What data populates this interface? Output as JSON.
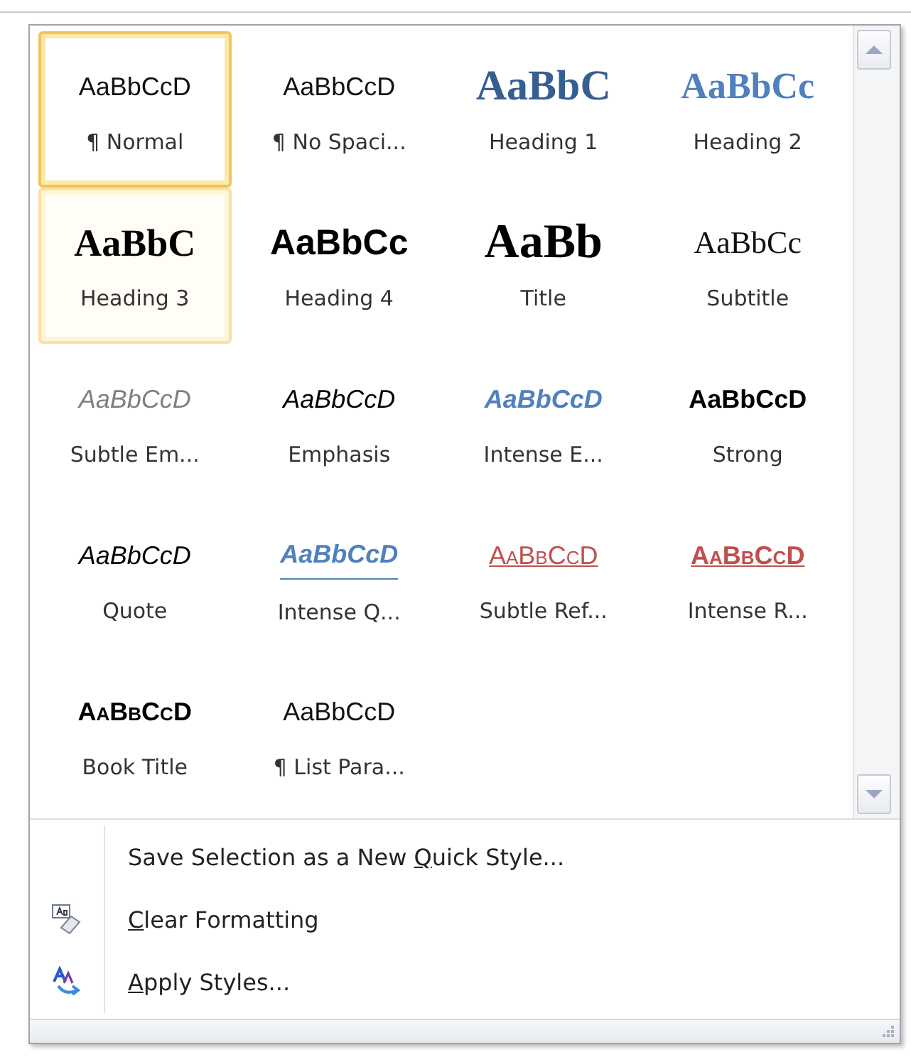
{
  "styles": [
    {
      "preview": "AaBbCcD",
      "label": "¶ Normal",
      "kind": "normal",
      "selected": true,
      "hovered": false
    },
    {
      "preview": "AaBbCcD",
      "label": "¶ No Spaci...",
      "kind": "no_spacing",
      "selected": false,
      "hovered": false
    },
    {
      "preview": "AaBbC",
      "label": "Heading 1",
      "kind": "heading1",
      "selected": false,
      "hovered": false
    },
    {
      "preview": "AaBbCc",
      "label": "Heading 2",
      "kind": "heading2",
      "selected": false,
      "hovered": false
    },
    {
      "preview": "AaBbC",
      "label": "Heading 3",
      "kind": "heading3",
      "selected": false,
      "hovered": true
    },
    {
      "preview": "AaBbCc",
      "label": "Heading 4",
      "kind": "heading4",
      "selected": false,
      "hovered": false
    },
    {
      "preview": "AaBb",
      "label": "Title",
      "kind": "title",
      "selected": false,
      "hovered": false
    },
    {
      "preview": "AaBbCc",
      "label": "Subtitle",
      "kind": "subtitle",
      "selected": false,
      "hovered": false
    },
    {
      "preview": "AaBbCcD",
      "label": "Subtle Em...",
      "kind": "subtle_emphasis",
      "selected": false,
      "hovered": false
    },
    {
      "preview": "AaBbCcD",
      "label": "Emphasis",
      "kind": "emphasis",
      "selected": false,
      "hovered": false
    },
    {
      "preview": "AaBbCcD",
      "label": "Intense E...",
      "kind": "intense_emphasis",
      "selected": false,
      "hovered": false
    },
    {
      "preview": "AaBbCcD",
      "label": "Strong",
      "kind": "strong",
      "selected": false,
      "hovered": false
    },
    {
      "preview": "AaBbCcD",
      "label": "Quote",
      "kind": "quote",
      "selected": false,
      "hovered": false
    },
    {
      "preview": "AaBbCcD",
      "label": "Intense Q...",
      "kind": "intense_quote",
      "selected": false,
      "hovered": false
    },
    {
      "preview": "AaBbCcD",
      "label": "Subtle Ref...",
      "kind": "subtle_reference",
      "selected": false,
      "hovered": false
    },
    {
      "preview": "AaBbCcD",
      "label": "Intense R...",
      "kind": "intense_reference",
      "selected": false,
      "hovered": false
    },
    {
      "preview": "AaBbCcD",
      "label": "Book Title",
      "kind": "book_title",
      "selected": false,
      "hovered": false
    },
    {
      "preview": "AaBbCcD",
      "label": "¶ List Para...",
      "kind": "list_paragraph",
      "selected": false,
      "hovered": false
    }
  ],
  "menu_items": [
    {
      "before": "Save Selection as a New ",
      "key": "Q",
      "after": "uick Style...",
      "kind": "save"
    },
    {
      "key": "C",
      "after": "lear Formatting",
      "kind": "clear"
    },
    {
      "key": "A",
      "after": "pply Styles...",
      "kind": "apply"
    }
  ]
}
